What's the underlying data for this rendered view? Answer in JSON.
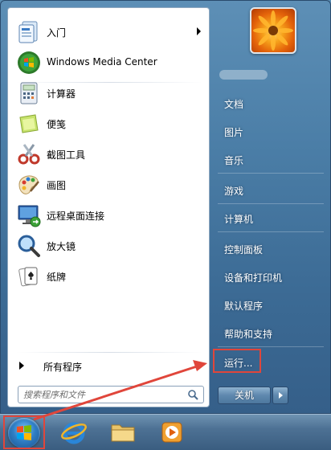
{
  "start_menu": {
    "programs": [
      {
        "label": "入门",
        "icon": "getting-started-icon",
        "has_submenu": true
      },
      {
        "label": "Windows Media Center",
        "icon": "media-center-icon",
        "has_submenu": false
      },
      {
        "label": "计算器",
        "icon": "calculator-icon",
        "has_submenu": false
      },
      {
        "label": "便笺",
        "icon": "sticky-notes-icon",
        "has_submenu": false
      },
      {
        "label": "截图工具",
        "icon": "snipping-tool-icon",
        "has_submenu": false
      },
      {
        "label": "画图",
        "icon": "paint-icon",
        "has_submenu": false
      },
      {
        "label": "远程桌面连接",
        "icon": "remote-desktop-icon",
        "has_submenu": false
      },
      {
        "label": "放大镜",
        "icon": "magnifier-icon",
        "has_submenu": false
      },
      {
        "label": "纸牌",
        "icon": "solitaire-icon",
        "has_submenu": false
      }
    ],
    "all_programs_label": "所有程序",
    "search": {
      "placeholder": "搜索程序和文件"
    },
    "right_items": [
      "文档",
      "图片",
      "音乐",
      "游戏",
      "计算机",
      "控制面板",
      "设备和打印机",
      "默认程序",
      "帮助和支持",
      "运行..."
    ],
    "shutdown_label": "关机"
  },
  "taskbar": {
    "icons": [
      "start-orb",
      "internet-explorer-icon",
      "explorer-folder-icon",
      "media-player-icon"
    ]
  },
  "colors": {
    "annotation_red": "#e0463b",
    "menu_blue": "#4b7ea7"
  }
}
